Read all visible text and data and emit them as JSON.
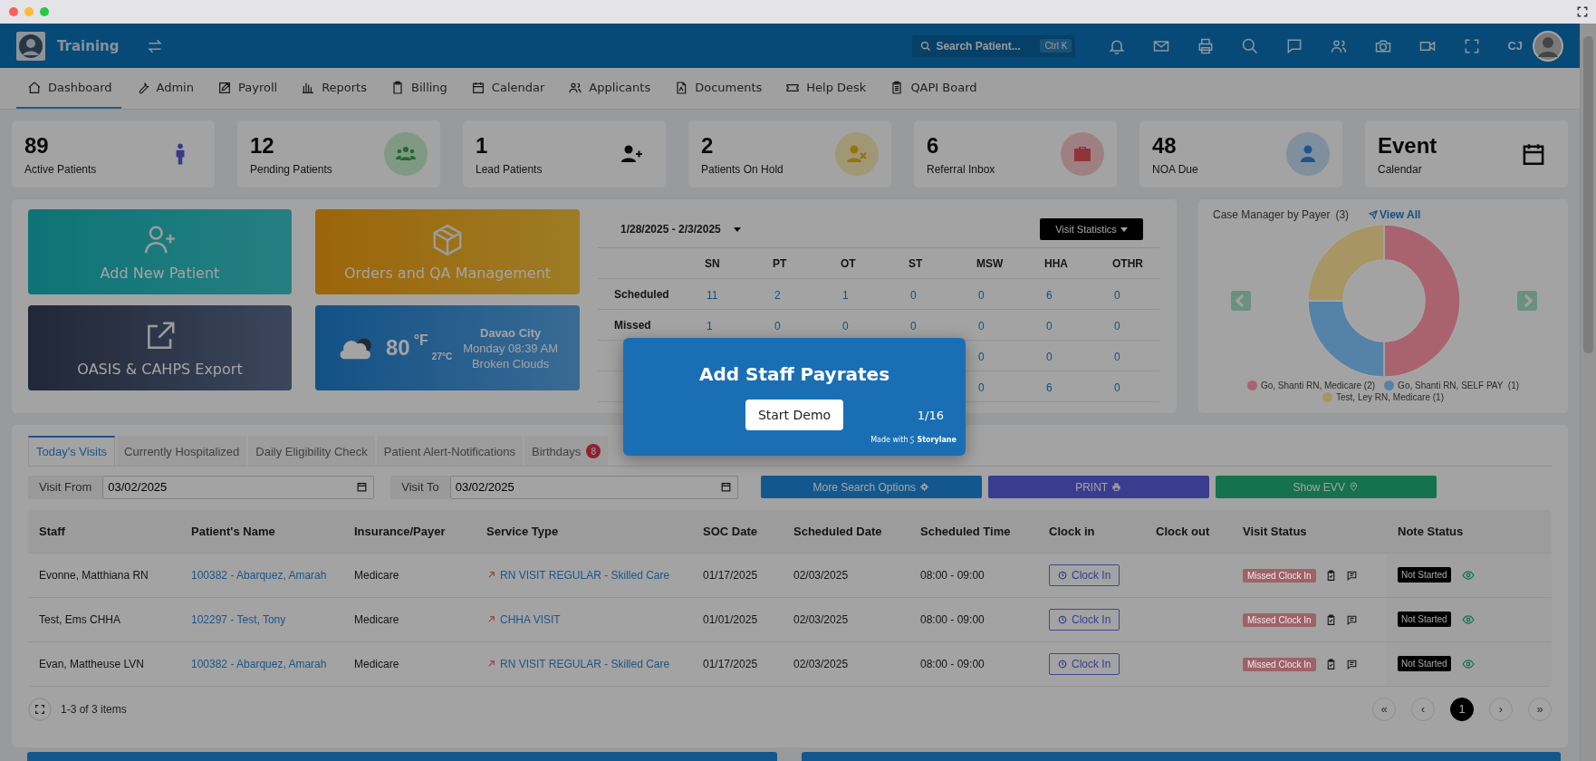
{
  "header": {
    "brand": "Training",
    "search": {
      "placeholder": "Search Patient...",
      "shortcut": "Ctrl K"
    },
    "user_initials": "CJ"
  },
  "nav": [
    {
      "label": "Dashboard",
      "selected": true
    },
    {
      "label": "Admin",
      "selected": false
    },
    {
      "label": "Payroll",
      "selected": false
    },
    {
      "label": "Reports",
      "selected": false
    },
    {
      "label": "Billing",
      "selected": false
    },
    {
      "label": "Calendar",
      "selected": false
    },
    {
      "label": "Applicants",
      "selected": false
    },
    {
      "label": "Documents",
      "selected": false
    },
    {
      "label": "Help Desk",
      "selected": false
    },
    {
      "label": "QAPI Board",
      "selected": false
    }
  ],
  "stat_cards": [
    {
      "value": "89",
      "label": "Active Patients",
      "kind": "person"
    },
    {
      "value": "12",
      "label": "Pending Patients",
      "kind": "group"
    },
    {
      "value": "1",
      "label": "Lead Patients",
      "kind": "user-plus"
    },
    {
      "value": "2",
      "label": "Patients On Hold",
      "kind": "user-x"
    },
    {
      "value": "6",
      "label": "Referral Inbox",
      "kind": "briefcase"
    },
    {
      "value": "48",
      "label": "NOA Due",
      "kind": "user"
    },
    {
      "value": "Event",
      "label": "Calendar",
      "kind": "calendar"
    }
  ],
  "action_tiles": [
    {
      "kind": "add-patient",
      "label": "Add New Patient"
    },
    {
      "kind": "orders",
      "label": "Orders and QA Management"
    },
    {
      "kind": "export",
      "label": "OASIS & CAHPS Export"
    }
  ],
  "weather": {
    "temp_f": "80",
    "unit_f": "°F",
    "temp_c": "27°C",
    "city": "Davao City",
    "time": "Monday 08:39 AM",
    "condition": "Broken Clouds"
  },
  "visit_stats": {
    "date_range": "1/28/2025 - 2/3/2025",
    "button": "Visit Statistics",
    "columns": [
      "SN",
      "PT",
      "OT",
      "ST",
      "MSW",
      "HHA",
      "OTHR"
    ],
    "rows": [
      {
        "label": "Scheduled",
        "values": {
          "SN": "11",
          "PT": "2",
          "OT": "1",
          "ST": "0",
          "MSW": "0",
          "HHA": "6",
          "OTHR": "0"
        }
      },
      {
        "label": "Missed",
        "values": {
          "SN": "1",
          "PT": "0",
          "OT": "0",
          "ST": "0",
          "MSW": "0",
          "HHA": "0",
          "OTHR": "0"
        }
      },
      {
        "values": {
          "MSW": "0",
          "HHA": "0",
          "OTHR": "0"
        }
      },
      {
        "values": {
          "MSW": "0",
          "HHA": "6",
          "OTHR": "0"
        }
      }
    ]
  },
  "case_manager": {
    "count": "(3)",
    "link": "View All",
    "chart_data": {
      "type": "donut",
      "title": "Case Manager by Payer",
      "categories": [
        "Go, Shanti RN, Medicare",
        "Go, Shanti RN, SELF PAY",
        "Test, Ley RN, Medicare"
      ],
      "series": [
        {
          "values": [
            50,
            25,
            25
          ]
        }
      ]
    },
    "legend": [
      {
        "count": "(2)",
        "color": "#a9636f"
      },
      {
        "count": " (1)",
        "color": "#5583a8"
      },
      {
        "count": "(1)",
        "color": "#a89565"
      }
    ]
  },
  "tabs": [
    {
      "label": "Today's Visits",
      "selected": true
    },
    {
      "label": "Currently Hospitalized",
      "selected": false
    },
    {
      "label": "Daily Eligibility Check",
      "selected": false
    },
    {
      "label": "Patient Alert-Notifications",
      "selected": false
    },
    {
      "label": "Birthdays",
      "selected": false,
      "badge": "8"
    }
  ],
  "filters": {
    "from_label": "Visit From",
    "from_value": "03/02/2025",
    "to_label": "Visit To",
    "to_value": "03/02/2025"
  },
  "buttons": [
    {
      "kind": "search",
      "label": "More Search Options"
    },
    {
      "kind": "print",
      "label": "PRINT"
    },
    {
      "kind": "evv",
      "label": "Show EVV"
    }
  ],
  "table": {
    "columns": [
      "Staff",
      "Patient's Name",
      "Insurance/Payer",
      "Service Type",
      "SOC Date",
      "Scheduled Date",
      "Scheduled Time",
      "Clock in",
      "Clock out",
      "Visit Status",
      "Note Status"
    ],
    "rows": [
      {
        "staff": "Evonne, Matthiana RN",
        "patient": "100382 - Abarquez, Amarah",
        "payer": "Medicare",
        "service": "RN VISIT REGULAR - Skilled Care",
        "soc": "01/17/2025",
        "date": "02/03/2025",
        "time": "08:00 - 09:00",
        "clock_in": "Clock In",
        "visit_status": "Missed Clock In",
        "note_status": "Not Started"
      },
      {
        "staff": "Test, Ems CHHA",
        "patient": "102297 - Test, Tony",
        "payer": "Medicare",
        "service": "CHHA VISIT",
        "soc": "01/01/2025",
        "date": "02/03/2025",
        "time": "08:00 - 09:00",
        "clock_in": "Clock In",
        "visit_status": "Missed Clock In",
        "note_status": "Not Started"
      },
      {
        "staff": "Evan, Mattheuse LVN",
        "patient": "100382 - Abarquez, Amarah",
        "payer": "Medicare",
        "service": "RN VISIT REGULAR - Skilled Care",
        "soc": "01/17/2025",
        "date": "02/03/2025",
        "time": "08:00 - 09:00",
        "clock_in": "Clock In",
        "visit_status": "Missed Clock In",
        "note_status": "Not Started"
      }
    ]
  },
  "pager": {
    "summary": "1-3 of 3 items",
    "pages": [
      {
        "label": "«",
        "selected": false
      },
      {
        "label": "‹",
        "selected": false
      },
      {
        "label": "1",
        "selected": true
      },
      {
        "label": "›",
        "selected": false
      },
      {
        "label": "»",
        "selected": false
      }
    ]
  },
  "popup": {
    "title": "Add Staff Payrates",
    "button": "Start Demo",
    "step": "1/16",
    "made_with": "Made with",
    "brand": "Storylane"
  }
}
